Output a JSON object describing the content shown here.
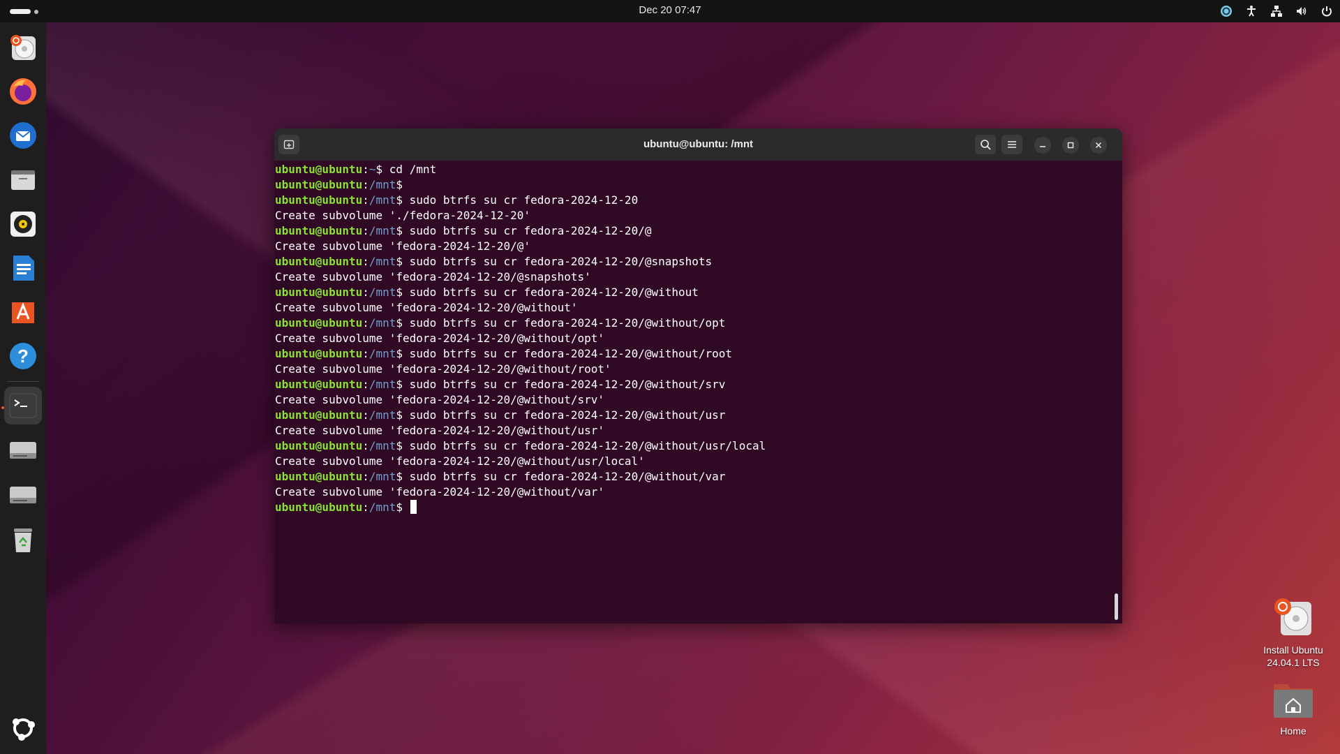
{
  "topbar": {
    "clock": "Dec 20  07:47"
  },
  "dock": {
    "items": [
      {
        "name": "install-ubuntu-dock-icon"
      },
      {
        "name": "firefox-icon"
      },
      {
        "name": "thunderbird-icon"
      },
      {
        "name": "files-icon"
      },
      {
        "name": "rhythmbox-icon"
      },
      {
        "name": "libreoffice-writer-icon"
      },
      {
        "name": "app-center-icon"
      },
      {
        "name": "help-icon"
      },
      {
        "name": "terminal-icon",
        "active": true
      },
      {
        "name": "drive-icon"
      },
      {
        "name": "drive-icon"
      },
      {
        "name": "trash-icon"
      }
    ],
    "apps_grid": "show-apps-icon"
  },
  "terminal": {
    "title": "ubuntu@ubuntu: /mnt",
    "lines": [
      {
        "user": "ubuntu@ubuntu",
        "path": "~",
        "cmd": " cd /mnt"
      },
      {
        "user": "ubuntu@ubuntu",
        "path": "/mnt",
        "cmd": ""
      },
      {
        "user": "ubuntu@ubuntu",
        "path": "/mnt",
        "cmd": " sudo btrfs su cr fedora-2024-12-20"
      },
      {
        "out": "Create subvolume './fedora-2024-12-20'"
      },
      {
        "user": "ubuntu@ubuntu",
        "path": "/mnt",
        "cmd": " sudo btrfs su cr fedora-2024-12-20/@"
      },
      {
        "out": "Create subvolume 'fedora-2024-12-20/@'"
      },
      {
        "user": "ubuntu@ubuntu",
        "path": "/mnt",
        "cmd": " sudo btrfs su cr fedora-2024-12-20/@snapshots"
      },
      {
        "out": "Create subvolume 'fedora-2024-12-20/@snapshots'"
      },
      {
        "user": "ubuntu@ubuntu",
        "path": "/mnt",
        "cmd": " sudo btrfs su cr fedora-2024-12-20/@without"
      },
      {
        "out": "Create subvolume 'fedora-2024-12-20/@without'"
      },
      {
        "user": "ubuntu@ubuntu",
        "path": "/mnt",
        "cmd": " sudo btrfs su cr fedora-2024-12-20/@without/opt"
      },
      {
        "out": "Create subvolume 'fedora-2024-12-20/@without/opt'"
      },
      {
        "user": "ubuntu@ubuntu",
        "path": "/mnt",
        "cmd": " sudo btrfs su cr fedora-2024-12-20/@without/root"
      },
      {
        "out": "Create subvolume 'fedora-2024-12-20/@without/root'"
      },
      {
        "user": "ubuntu@ubuntu",
        "path": "/mnt",
        "cmd": " sudo btrfs su cr fedora-2024-12-20/@without/srv"
      },
      {
        "out": "Create subvolume 'fedora-2024-12-20/@without/srv'"
      },
      {
        "user": "ubuntu@ubuntu",
        "path": "/mnt",
        "cmd": " sudo btrfs su cr fedora-2024-12-20/@without/usr"
      },
      {
        "out": "Create subvolume 'fedora-2024-12-20/@without/usr'"
      },
      {
        "user": "ubuntu@ubuntu",
        "path": "/mnt",
        "cmd": " sudo btrfs su cr fedora-2024-12-20/@without/usr/local"
      },
      {
        "out": "Create subvolume 'fedora-2024-12-20/@without/usr/local'"
      },
      {
        "user": "ubuntu@ubuntu",
        "path": "/mnt",
        "cmd": " sudo btrfs su cr fedora-2024-12-20/@without/var"
      },
      {
        "out": "Create subvolume 'fedora-2024-12-20/@without/var'"
      },
      {
        "user": "ubuntu@ubuntu",
        "path": "/mnt",
        "cmd": " ",
        "cursor": true
      }
    ]
  },
  "desktop": {
    "install_label_1": "Install Ubuntu",
    "install_label_2": "24.04.1 LTS",
    "home_label": "Home"
  },
  "colors": {
    "terminal_bg": "#300a24",
    "prompt_user": "#8ae234",
    "prompt_path": "#729fcf",
    "accent": "#e95420"
  }
}
